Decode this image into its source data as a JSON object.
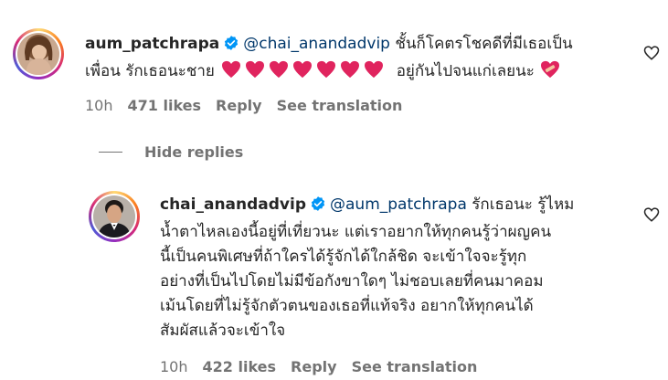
{
  "comment1": {
    "username": "aum_patchrapa",
    "mention": "@chai_anandadvip",
    "text_line1": "ชั้นก็โคตรโชคดีที่มีเธอเป็น",
    "text_line2a": "เพื่อน รักเธอนะชาย",
    "text_line2b": "อยู่กันไปจนแก่เลยนะ",
    "time": "10h",
    "likes": "471 likes",
    "reply": "Reply",
    "translate": "See translation",
    "avatar_icon": "profile-photo-woman"
  },
  "hide_replies_label": "Hide replies",
  "comment2": {
    "username": "chai_anandadvip",
    "mention": "@aum_patchrapa",
    "text_first": "รักเธอนะ รู้ไหม",
    "lines": [
      "น้ำตาไหลเองนี้อยู่ที่เที่ยวนะ แต่เราอยากให้ทุกคนรู้ว่าผญคน",
      "นี้เป็นคนพิเศษที่ถ้าใครได้รู้จักได้ใกล้ชิด จะเข้าใจจะรู้ทุก",
      "อย่างที่เป็นไปโดยไม่มีข้อกังขาใดๆ ไม่ชอบเลยที่คนมาคอม",
      "เม้นโดยที่ไม่รู้จักตัวตนของเธอที่แท้จริง อยากให้ทุกคนได้",
      "สัมผัสแล้วจะเข้าใจ"
    ],
    "time": "10h",
    "likes": "422 likes",
    "reply": "Reply",
    "translate": "See translation",
    "avatar_icon": "profile-photo-man"
  },
  "colors": {
    "mention": "#00376b",
    "verified": "#0095f6",
    "heart": "#e0245e",
    "meta_gray": "#737373"
  }
}
